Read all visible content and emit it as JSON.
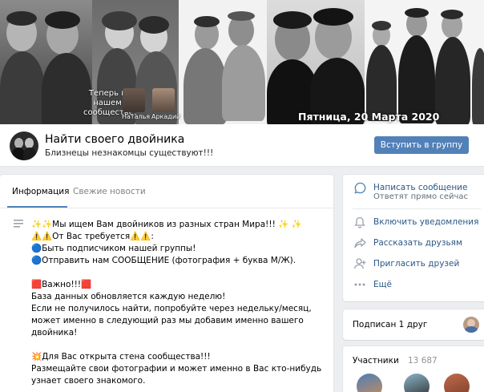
{
  "cover": {
    "caption": "Теперь в нашем сообществе:",
    "new_members": [
      "Наталья",
      "Аркадий"
    ],
    "date": "Пятница, 20 Марта 2020"
  },
  "group": {
    "name": "Найти своего двойника",
    "status": "Близнецы незнакомцы существуют!!!",
    "join_label": "Вступить в группу"
  },
  "tabs": [
    {
      "label": "Информация",
      "active": true
    },
    {
      "label": "Свежие новости",
      "active": false
    }
  ],
  "description": "✨✨Мы ищем Вам двойников из разных стран Мира!!! ✨ ✨\n⚠️⚠️От Вас требуется⚠️⚠️:\n🔵Быть подписчиком нашей группы!\n🔵Отправить нам СООБЩЕНИЕ (фотография + буква М/Ж).\n\n🟥Важно!!!🟥\nБаза данных обновляется каждую неделю!\nЕсли не получилось найти, попробуйте через недельку/месяц, может именно в следующий раз мы добавим именно вашего двойника!\n\n💥Для Вас открыта стена сообщества!!!\nРазмещайте свои фотографии и может именно в Вас кто-нибудь узнает своего знакомого.",
  "menu": {
    "message": {
      "label": "Написать сообщение",
      "sub": "Ответят прямо сейчас"
    },
    "items": [
      {
        "label": "Включить уведомления",
        "icon": "bell-icon"
      },
      {
        "label": "Рассказать друзьям",
        "icon": "share-icon"
      },
      {
        "label": "Пригласить друзей",
        "icon": "add-user-icon"
      },
      {
        "label": "Ещё",
        "icon": "more-icon"
      }
    ]
  },
  "friends": {
    "label": "Подписан 1 друг"
  },
  "members": {
    "label": "Участники",
    "count": "13 687"
  },
  "colors": {
    "accent": "#5181b8",
    "link": "#2a5885",
    "background": "#edeef0"
  }
}
